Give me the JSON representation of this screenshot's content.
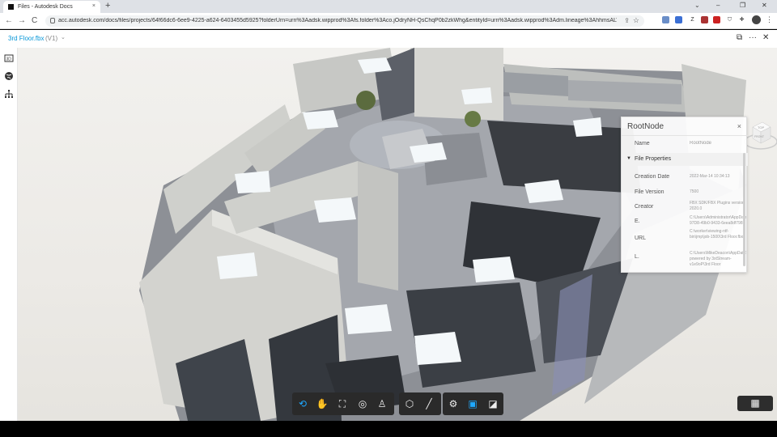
{
  "browser": {
    "tab_title": "Files - Autodesk Docs",
    "tab_close": "×",
    "new_tab": "+",
    "url": "acc.autodesk.com/docs/files/projects/64f66dc6-6ee9-4225-a624-6403455d5925?folderUrn=urn%3Aadsk.wipprod%3Afs.folder%3Aco.jOdryNH-QsChqP0b2zkWhg&entityId=urn%3Aadsk.wipprod%3Adm.lineage%3AhhmsALV9Q...",
    "back": "←",
    "forward": "→",
    "reload": "C",
    "minimize": "–",
    "restore": "❐",
    "close": "✕",
    "tab_search": "⌄"
  },
  "app": {
    "file_title": "3rd Floor.fbx",
    "file_version": "(V1)",
    "dropdown_chevron": "⌄",
    "compare_icon": "⧉",
    "more": "···",
    "close": "✕"
  },
  "properties_panel": {
    "title": "RootNode",
    "close": "×",
    "name_key": "Name",
    "name_value": "RootNode",
    "section_label": "File Properties",
    "rows": [
      {
        "key": "Creation Date",
        "value": "2022-Mar-14 10:34:13"
      },
      {
        "key": "File Version",
        "value": "7500"
      },
      {
        "key": "Creator",
        "value": "FBX SDK/FBX Plugins version 2020.0"
      },
      {
        "key": "E.",
        "value": "C:\\Users\\Administrator\\AppData\\Local\\Te... 97D8-49b0-9433-6eea8df7981"
      },
      {
        "key": "URL",
        "value": "C:\\worker\\viewing-ntf-bin\\jmp\\job-1500\\3rd Floor.fbx"
      },
      {
        "key": "L.",
        "value": "C:\\Users\\MikeDeacon\\AppData\\Local\\Tem powered by 3xtStream-v1e9oP\\3rd Floor"
      }
    ]
  },
  "viewcube": {
    "top": "TOP",
    "front": "FRONT"
  },
  "toolbar": {
    "groups": [
      [
        "orbit-icon",
        "pan-icon",
        "fit-view-icon",
        "first-person-icon",
        "walk-icon"
      ],
      [
        "explode-icon",
        "measure-icon"
      ],
      [
        "settings-icon",
        "model-browser-icon",
        "properties-icon"
      ]
    ],
    "active": "orbit-icon"
  },
  "accent_color": "#0696d7"
}
